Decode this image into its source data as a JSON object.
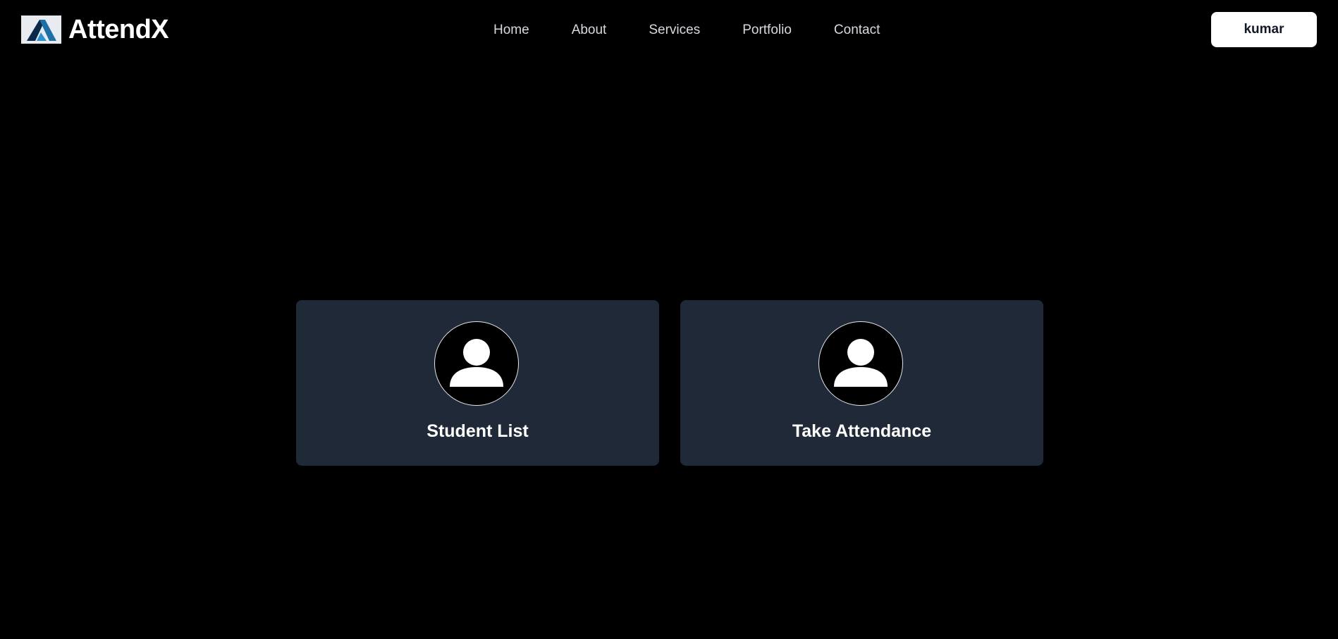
{
  "header": {
    "brand_name": "AttendX",
    "logo_icon": "attendx-logo-icon",
    "nav": [
      {
        "label": "Home"
      },
      {
        "label": "About"
      },
      {
        "label": "Services"
      },
      {
        "label": "Portfolio"
      },
      {
        "label": "Contact"
      }
    ],
    "user_button_label": "kumar"
  },
  "cards": [
    {
      "label": "Student List",
      "icon": "user-avatar-icon"
    },
    {
      "label": "Take Attendance",
      "icon": "user-avatar-icon"
    }
  ],
  "colors": {
    "background": "#000000",
    "card_background": "#1f2937",
    "text": "#ffffff",
    "nav_text": "#d6d9de",
    "button_background": "#ffffff",
    "button_text": "#111827",
    "logo_blue": "#1e6fa8",
    "logo_dark": "#0b2a4a"
  }
}
